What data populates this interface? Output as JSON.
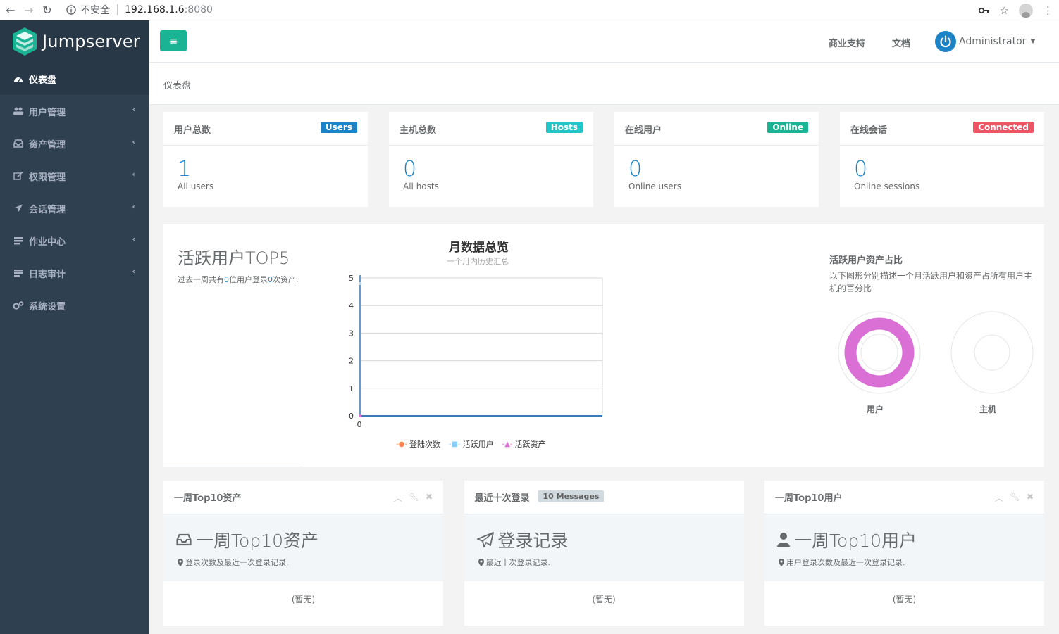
{
  "browser": {
    "security": "不安全",
    "url": "192.168.1.6",
    "port": ":8080"
  },
  "sidebar": {
    "logo": "Jumpserver",
    "items": [
      {
        "label": "仪表盘",
        "icon": "dashboard-icon",
        "active": true
      },
      {
        "label": "用户管理",
        "icon": "users-icon"
      },
      {
        "label": "资产管理",
        "icon": "inbox-icon"
      },
      {
        "label": "权限管理",
        "icon": "edit-icon"
      },
      {
        "label": "会话管理",
        "icon": "rocket-icon"
      },
      {
        "label": "作业中心",
        "icon": "tasks-icon"
      },
      {
        "label": "日志审计",
        "icon": "log-icon"
      },
      {
        "label": "系统设置",
        "icon": "gears-icon"
      }
    ],
    "caret": "‹"
  },
  "topbar": {
    "support": "商业支持",
    "docs": "文档",
    "user": "Administrator"
  },
  "breadcrumb": "仪表盘",
  "stats": [
    {
      "title": "用户总数",
      "badge": "Users",
      "value": "1",
      "sub": "All users",
      "color": "#1c84c6"
    },
    {
      "title": "主机总数",
      "badge": "Hosts",
      "value": "0",
      "sub": "All hosts",
      "color": "#23c6c8"
    },
    {
      "title": "在线用户",
      "badge": "Online",
      "value": "0",
      "sub": "Online users",
      "color": "#1ab394"
    },
    {
      "title": "在线会话",
      "badge": "Connected",
      "value": "0",
      "sub": "Online sessions",
      "color": "#ed5565"
    }
  ],
  "top5": {
    "title": "活跃用户TOP5",
    "desc_pre": "过去一周共有",
    "desc_users": "0",
    "desc_mid": "位用户登录",
    "desc_assets": "0",
    "desc_post": "次资产."
  },
  "chart_data": {
    "type": "line",
    "title": "月数据总览",
    "subtitle": "一个月内历史汇总",
    "categories": [
      "0"
    ],
    "series": [
      {
        "name": "登陆次数",
        "values": [
          0
        ],
        "color": "#f8834f"
      },
      {
        "name": "活跃用户",
        "values": [
          0
        ],
        "color": "#87cefa"
      },
      {
        "name": "活跃资产",
        "values": [
          0
        ],
        "color": "#da70d6"
      }
    ],
    "ylim": [
      0,
      5
    ],
    "yticks": [
      "0",
      "1",
      "2",
      "3",
      "4",
      "5"
    ],
    "grid": true,
    "legend": "bottom"
  },
  "ratio": {
    "title": "活跃用户资产占比",
    "desc": "以下图形分别描述一个月活跃用户和资产占所有用户主机的百分比",
    "donuts": [
      {
        "label": "用户",
        "color": "#da70d6"
      },
      {
        "label": "主机",
        "color": "#ffffff"
      }
    ]
  },
  "panels": [
    {
      "title": "一周Top10资产",
      "big": "一周Top10资产",
      "small": "登录次数及最近一次登录记录.",
      "empty": "(暂无)",
      "icon": "inbox-icon"
    },
    {
      "title": "最近十次登录",
      "badge": "10 Messages",
      "big": "登录记录",
      "small": "最近十次登录记录.",
      "empty": "(暂无)",
      "icon": "paper-plane-icon"
    },
    {
      "title": "一周Top10用户",
      "big": "一周Top10用户",
      "small": "用户登录次数及最近一次登录记录.",
      "empty": "(暂无)",
      "icon": "user-icon"
    }
  ]
}
